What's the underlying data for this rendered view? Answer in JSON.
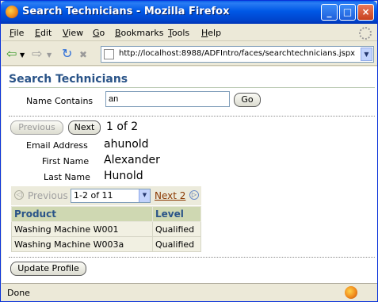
{
  "window": {
    "title": "Search Technicians - Mozilla Firefox",
    "min_label": "_",
    "max_label": "□",
    "close_label": "×"
  },
  "menu": [
    {
      "label": "File",
      "key": "F"
    },
    {
      "label": "Edit",
      "key": "E"
    },
    {
      "label": "View",
      "key": "V"
    },
    {
      "label": "Go",
      "key": "G"
    },
    {
      "label": "Bookmarks",
      "key": "B"
    },
    {
      "label": "Tools",
      "key": "T"
    },
    {
      "label": "Help",
      "key": "H"
    }
  ],
  "nav": {
    "back_glyph": "⇦",
    "forward_glyph": "⇨",
    "reload_glyph": "↻",
    "stop_glyph": "✖",
    "home_glyph": "⌂",
    "url": "http://localhost:8988/ADFIntro/faces/searchtechnicians.jspx",
    "dropdown_glyph": "▼"
  },
  "page": {
    "title": "Search Technicians",
    "search": {
      "label": "Name Contains",
      "value": "an",
      "go_label": "Go"
    },
    "record_nav": {
      "previous_label": "Previous",
      "next_label": "Next",
      "position": "1 of 2"
    },
    "record": {
      "email_label": "Email Address",
      "email": "ahunold",
      "first_label": "First Name",
      "first": "Alexander",
      "last_label": "Last Name",
      "last": "Hunold"
    },
    "table_nav": {
      "previous_glyph": "◁",
      "previous_label": "Previous",
      "range": "1-2 of 11",
      "range_drop": "▼",
      "next_label": "Next 2",
      "next_glyph": "▷"
    },
    "table": {
      "headers": [
        "Product",
        "Level"
      ],
      "rows": [
        [
          "Washing Machine W001",
          "Qualified"
        ],
        [
          "Washing Machine W003a",
          "Qualified"
        ]
      ]
    },
    "update_label": "Update Profile"
  },
  "status": {
    "text": "Done"
  },
  "colors": {
    "title_bar": "#0058e6",
    "page_title": "#2a5488",
    "table_header": "#cfd8b2",
    "table_row": "#f1f0e2",
    "link": "#8a3800"
  }
}
